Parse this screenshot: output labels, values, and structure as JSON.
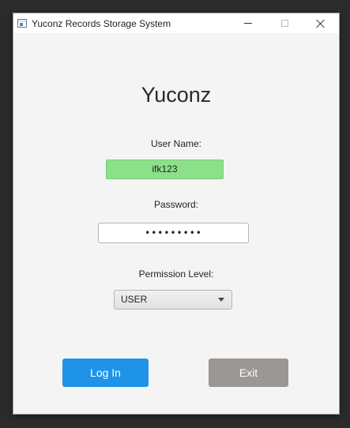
{
  "window": {
    "title": "Yuconz Records Storage System"
  },
  "app": {
    "heading": "Yuconz"
  },
  "form": {
    "username_label": "User Name:",
    "username_value": "ifk123",
    "password_label": "Password:",
    "password_masked": "•••••••••",
    "permission_label": "Permission Level:",
    "permission_selected": "USER"
  },
  "buttons": {
    "login_label": "Log In",
    "exit_label": "Exit"
  },
  "colors": {
    "username_valid_bg": "#8de08a",
    "login_button": "#1e93e8",
    "exit_button": "#9a9794"
  },
  "icons": {
    "app": "app-window-icon",
    "minimize": "minimize-icon",
    "maximize": "maximize-icon",
    "close": "close-icon",
    "dropdown": "chevron-down-icon"
  }
}
